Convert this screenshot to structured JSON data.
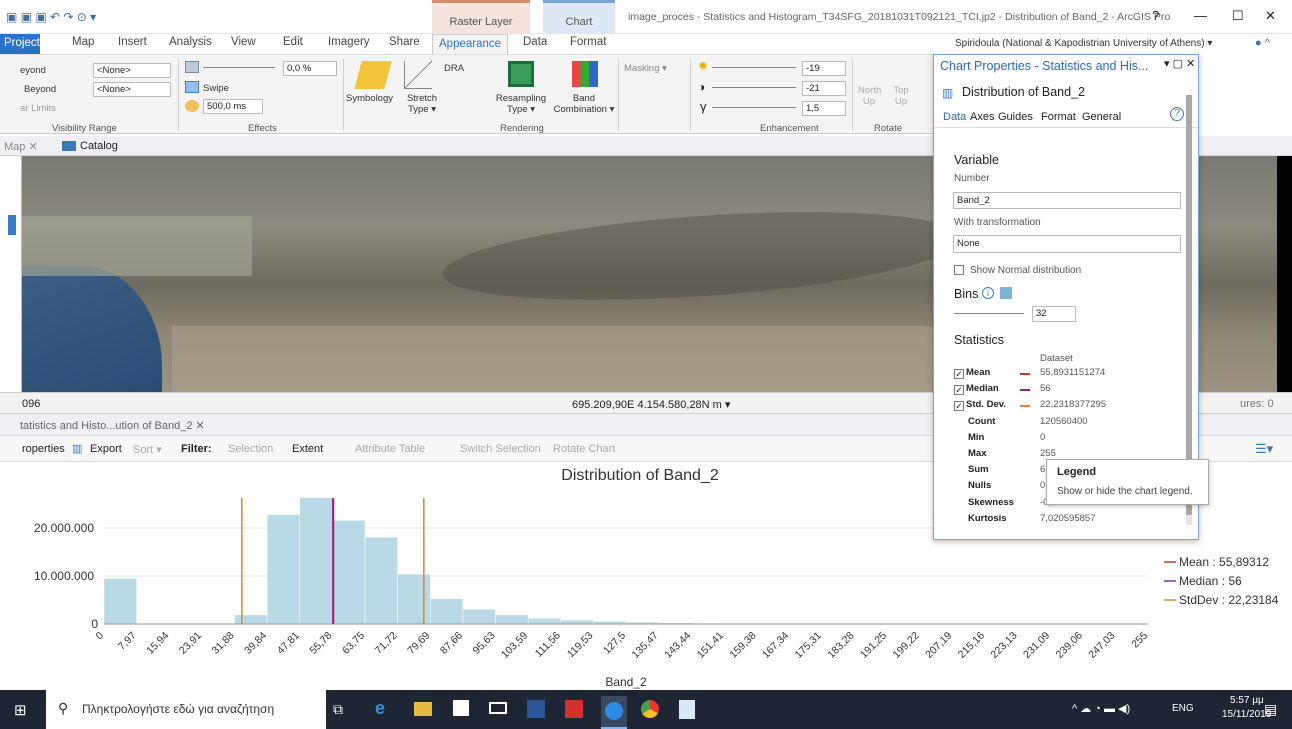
{
  "titlebar": {
    "context_raster": "Raster Layer",
    "context_chart": "Chart",
    "doc_title": "image_proces - Statistics and Histogram_T34SFG_20181031T092121_TCI.jp2 - Distribution of Band_2 - ArcGIS Pro",
    "help": "?",
    "minimize": "—",
    "maximize": "☐",
    "close": "✕"
  },
  "menubar": {
    "items": [
      "Project",
      "Map",
      "Insert",
      "Analysis",
      "View",
      "Edit",
      "Imagery",
      "Share",
      "Appearance",
      "Data",
      "Format"
    ],
    "user": "Spiridoula (National & Kapodistrian University of Athens) ▾"
  },
  "ribbon": {
    "vis": {
      "r1": "eyond",
      "r2": "Beyond",
      "r3": "ar Limits",
      "combo1": "<None>",
      "combo2": "<None>",
      "label": "Visibility Range"
    },
    "effects": {
      "pct": "0,0 %",
      "swipe": "Swipe",
      "ms": "500,0 ms",
      "label": "Effects"
    },
    "rendering": {
      "symbology": "Symbology",
      "stretch": "Stretch Type ▾",
      "dra": "DRA",
      "resampling": "Resampling Type ▾",
      "band": "Band Combination ▾",
      "label": "Rendering"
    },
    "enhance": {
      "masking": "Masking ▾",
      "v1": "-19",
      "v2": "-21",
      "v3": "1,5",
      "label": "Enhancement"
    },
    "rotate": {
      "north": "North Up",
      "top": "Top Up",
      "label": "Rotate"
    }
  },
  "viewtabs": {
    "map": "Map ✕",
    "catalog": "Catalog"
  },
  "status": {
    "scale": "096",
    "coords": "695.209,90E 4.154.580,28N m ▾",
    "features": "ures: 0"
  },
  "charttab": {
    "label": "tatistics and Histo...ution of Band_2 ✕"
  },
  "charttoolbar": {
    "properties": "roperties",
    "export": "Export",
    "sort": "Sort ▾",
    "filter": "Filter:",
    "selection": "Selection",
    "extent": "Extent",
    "attr": "Attribute Table",
    "switch": "Switch Selection",
    "rotate": "Rotate Chart"
  },
  "panel": {
    "title": "Chart Properties - Statistics and His...",
    "subtitle": "Distribution of Band_2",
    "tabs": [
      "Data",
      "Axes",
      "Guides",
      "Format",
      "General"
    ],
    "variable": "Variable",
    "number": "Number",
    "band": "Band_2",
    "with_transform": "With transformation",
    "transform": "None",
    "show_normal": "Show Normal distribution",
    "bins": "Bins",
    "bins_val": "32",
    "statistics": "Statistics",
    "dataset": "Dataset",
    "stats": [
      {
        "name": "Mean",
        "value": "55,8931151274",
        "checked": true,
        "color": "#c0392b"
      },
      {
        "name": "Median",
        "value": "56",
        "checked": true,
        "color": "#8e2a8e"
      },
      {
        "name": "Std. Dev.",
        "value": "22,2318377295",
        "checked": true,
        "color": "#d4883a"
      },
      {
        "name": "Count",
        "value": "120560400"
      },
      {
        "name": "Min",
        "value": "0"
      },
      {
        "name": "Max",
        "value": "255"
      },
      {
        "name": "Sum",
        "value": "6"
      },
      {
        "name": "Nulls",
        "value": "0"
      },
      {
        "name": "Skewness",
        "value": "-0,2247585117"
      },
      {
        "name": "Kurtosis",
        "value": "7,020595857"
      }
    ]
  },
  "tooltip": {
    "title": "Legend",
    "text": "Show or hide the chart legend."
  },
  "chart_data": {
    "type": "bar",
    "title": "Distribution of Band_2",
    "xlabel": "Band_2",
    "ylabel": "",
    "categories": [
      "0",
      "7,97",
      "15,94",
      "23,91",
      "31,88",
      "39,84",
      "47,81",
      "55,78",
      "63,75",
      "71,72",
      "79,69",
      "87,66",
      "95,63",
      "103,59",
      "111,56",
      "119,53",
      "127,5",
      "135,47",
      "143,44",
      "151,41",
      "159,38",
      "167,34",
      "175,31",
      "183,28",
      "191,25",
      "199,22",
      "207,19",
      "215,16",
      "223,13",
      "231,09",
      "239,06",
      "247,03",
      "255"
    ],
    "values": [
      9500000,
      0,
      0,
      0,
      1900000,
      22800000,
      26300000,
      21600000,
      18100000,
      10400000,
      5300000,
      3100000,
      1900000,
      1200000,
      800000,
      550000,
      380000,
      260000,
      180000,
      120000,
      90000,
      70000,
      50000,
      40000,
      30000,
      25000,
      20000,
      15000,
      12000,
      10000,
      8000,
      20000
    ],
    "ylim": [
      0,
      30000000
    ],
    "yticks": [
      "0",
      "10.000.000",
      "20.000.000"
    ],
    "mean": 55.89312,
    "median": 56,
    "std_lo": 33.66,
    "std_hi": 78.12,
    "legend": [
      "Mean : 55,89312",
      "Median : 56",
      "StdDev : 22,23184"
    ],
    "colors": {
      "bar": "#b9d9e6",
      "mean": "#c0392b",
      "median": "#8e2a8e",
      "std": "#d4883a"
    }
  },
  "taskbar": {
    "search": "Πληκτρολογήστε εδώ για αναζήτηση",
    "lang": "ENG",
    "time": "5:57 μμ",
    "date": "15/11/2019"
  }
}
